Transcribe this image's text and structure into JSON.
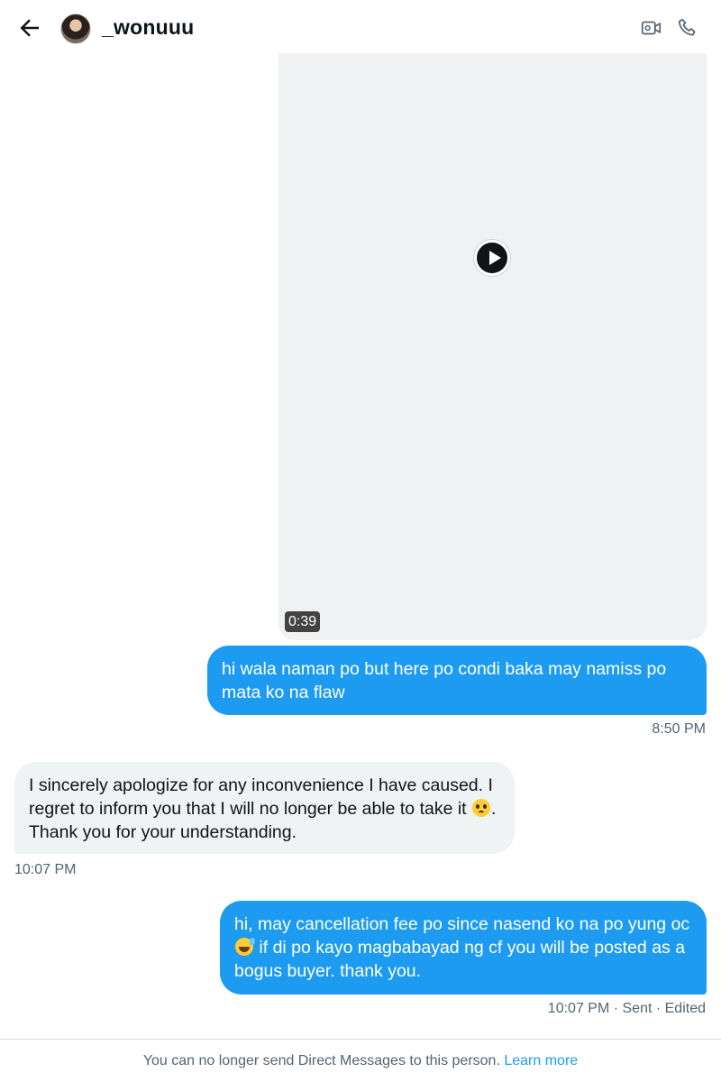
{
  "header": {
    "username": "_wonuuu",
    "icons": [
      "back-arrow-icon",
      "video-call-icon",
      "phone-call-icon"
    ]
  },
  "video": {
    "duration": "0:39"
  },
  "messages": [
    {
      "direction": "sent",
      "text": "hi wala naman po but here po condi baka may namiss po mata ko na flaw",
      "time": "8:50 PM"
    },
    {
      "direction": "received",
      "text_before": "I sincerely apologize for any inconvenience I have caused. I regret to inform you that I will no longer be able to take it ",
      "emoji": "pleading-face",
      "text_after": ". Thank you for your understanding.",
      "time": "10:07 PM"
    },
    {
      "direction": "sent",
      "text_before": "hi, may cancellation fee po since nasend ko na po yung oc",
      "emoji": "grinning-sweat",
      "text_after": " if di po kayo magbabayad ng cf you will be posted as a bogus buyer. thank you.",
      "time": "10:07 PM · Sent · Edited"
    }
  ],
  "footer": {
    "notice": "You can no longer send Direct Messages to this person.",
    "link": "Learn more"
  },
  "colors": {
    "accent": "#1d9bf0",
    "received_bubble": "#eff3f4",
    "muted_text": "#536471"
  }
}
